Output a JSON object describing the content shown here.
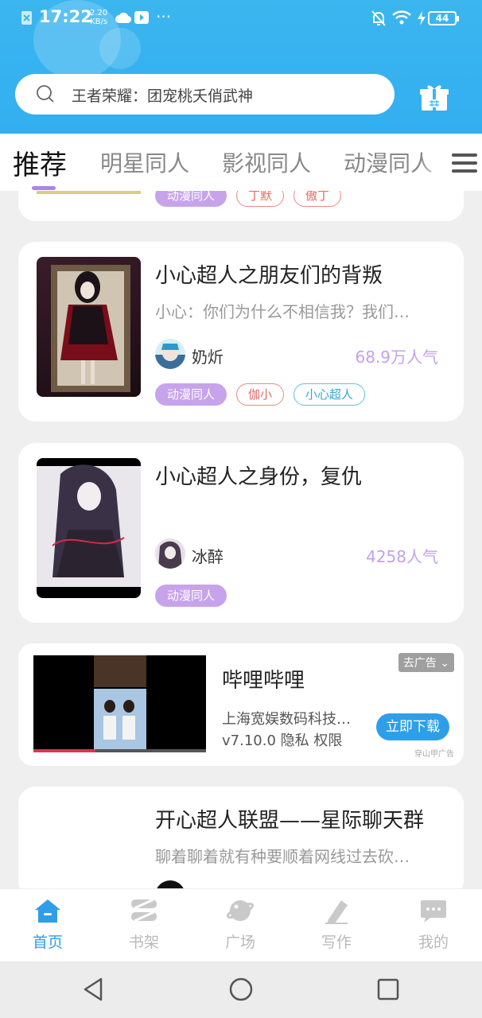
{
  "status_bar": {
    "time": "17:22",
    "speed_value": "2.20",
    "speed_unit": "KB/s",
    "more": "···",
    "battery": "44"
  },
  "search": {
    "placeholder": "王者荣耀：团宠桃夭俏武神"
  },
  "tabs": [
    {
      "label": "推荐",
      "active": true
    },
    {
      "label": "明星同人"
    },
    {
      "label": "影视同人"
    },
    {
      "label": "动漫同人"
    }
  ],
  "partial_card": {
    "tags": [
      "动漫同人",
      "丁默",
      "傲丁"
    ]
  },
  "books": [
    {
      "title": "小心超人之朋友们的背叛",
      "desc": "小心：你们为什么不相信我？我们…",
      "author": "奶炘",
      "popularity": "68.9万人气",
      "tags": [
        "动漫同人",
        "伽小",
        "小心超人"
      ]
    },
    {
      "title": "小心超人之身份，复仇",
      "desc": "",
      "author": "冰醉",
      "popularity": "4258人气",
      "tags": [
        "动漫同人"
      ]
    }
  ],
  "ad": {
    "name": "哔哩哔哩",
    "company": "上海宽娱数码科技…",
    "version": "v7.10.0",
    "privacy": "隐私",
    "permission": "权限",
    "close": "去广告",
    "cta": "立即下载",
    "source": "穿山甲广告"
  },
  "partial_book": {
    "title": "开心超人联盟——星际聊天群",
    "desc": "聊着聊着就有种要顺着网线过去砍…"
  },
  "bottom_nav": [
    {
      "label": "首页",
      "icon": "home-icon",
      "active": true
    },
    {
      "label": "书架",
      "icon": "bookshelf-icon"
    },
    {
      "label": "广场",
      "icon": "planet-icon"
    },
    {
      "label": "写作",
      "icon": "pen-icon"
    },
    {
      "label": "我的",
      "icon": "chat-bubble-icon"
    }
  ],
  "colors": {
    "header": "#3bb6ef",
    "accent": "#2e9ee8",
    "tag_purple": "#c7a3ec",
    "popularity": "#c4a1ee"
  }
}
